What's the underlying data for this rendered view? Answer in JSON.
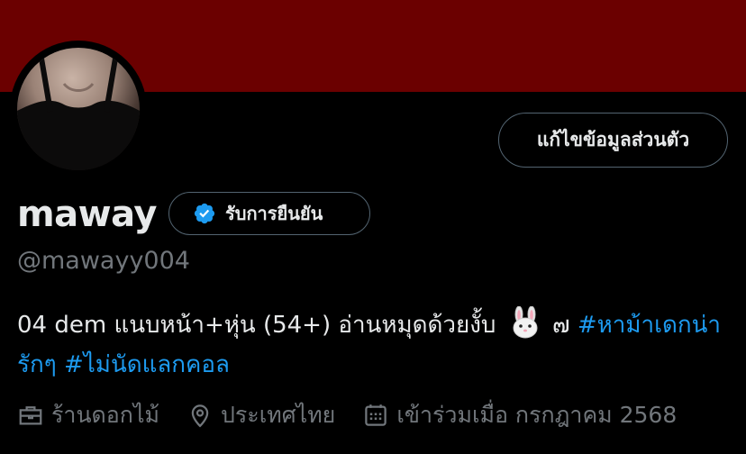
{
  "colors": {
    "banner": "#6b0000",
    "background": "#000000",
    "text_primary": "#e7e9ea",
    "text_secondary": "#71767b",
    "accent": "#1d9bf0",
    "border": "#536471"
  },
  "profile": {
    "display_name": "maway",
    "handle": "@mawayy004",
    "edit_button_label": "แก้ไขข้อมูลส่วนตัว",
    "verify_button_label": "รับการยืนยัน",
    "verify_icon": "verified-badge-icon"
  },
  "bio": {
    "text_part1": "04 dem แนบหน้า+หุ่น (54+) อ่านหมุดด้วยงั้บ",
    "emoji": "rabbit-face-icon",
    "text_part2": "๗",
    "hashtag1": "#หาม้าเดกน่ารักๆ",
    "hashtag2": "#ไม่นัดแลกคอล"
  },
  "meta": {
    "category": {
      "icon": "briefcase-icon",
      "label": "ร้านดอกไม้"
    },
    "location": {
      "icon": "location-pin-icon",
      "label": "ประเทศไทย"
    },
    "joined": {
      "icon": "calendar-icon",
      "label": "เข้าร่วมเมื่อ กรกฎาคม 2568"
    }
  }
}
